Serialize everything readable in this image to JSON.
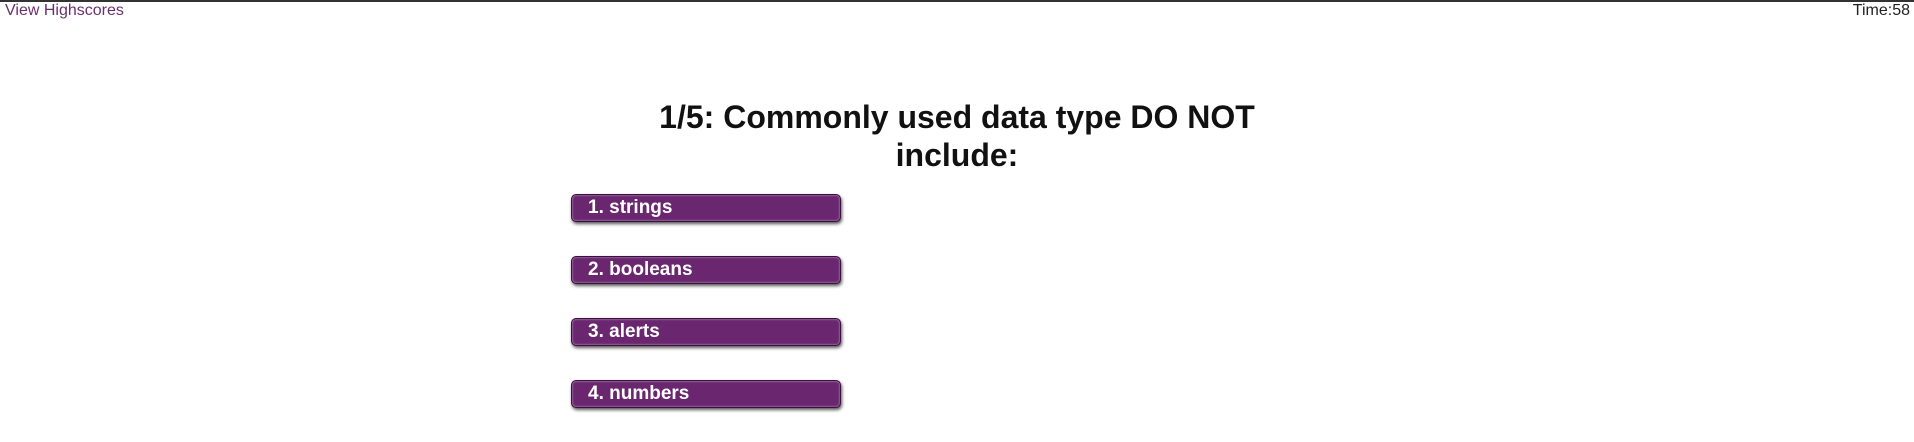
{
  "header": {
    "highscores_link": "View Highscores",
    "timer_label": "Time:",
    "timer_value": "58"
  },
  "quiz": {
    "question": "1/5: Commonly used data type DO NOT include:",
    "answers": [
      {
        "label": "1. strings"
      },
      {
        "label": "2. booleans"
      },
      {
        "label": "3. alerts"
      },
      {
        "label": "4. numbers"
      }
    ]
  },
  "colors": {
    "accent": "#6a2770",
    "link": "#6b2f6e"
  }
}
